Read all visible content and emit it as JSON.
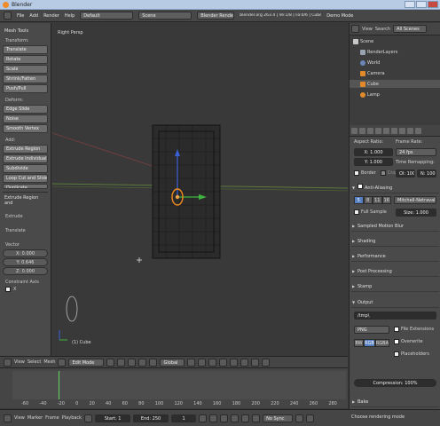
{
  "window": {
    "title": "Blender"
  },
  "menubar": {
    "items": [
      "File",
      "Add",
      "Render",
      "Help"
    ],
    "layout": "Default",
    "scene": "Scene",
    "engine": "Blender Render",
    "stats": "blender.org 263.4 | Ve:1/8 | Fa:0/6 | Cube",
    "demo": "Demo Mode"
  },
  "toolshelf": {
    "title": "Mesh Tools",
    "transform": {
      "label": "Transform:",
      "items": [
        "Translate",
        "Rotate",
        "Scale",
        "Shrink/Fatten",
        "Push/Pull"
      ]
    },
    "deform": {
      "label": "Deform:",
      "items": [
        "Edge Slide",
        "Noise",
        "Smooth Vertex"
      ]
    },
    "add": {
      "label": "Add:",
      "items": [
        "Extrude Region",
        "Extrude Individual",
        "Subdivide",
        "Loop Cut and Slide",
        "Duplicate"
      ]
    },
    "operator": {
      "title": "Extrude Region and",
      "items": [
        "Extrude",
        "Translate"
      ],
      "vector_label": "Vector",
      "vector": [
        "X: 0.000",
        "Y: 0.646",
        "Z: 0.000"
      ],
      "constraint_label": "Constraint Axis",
      "constraint_x": "X"
    }
  },
  "viewport": {
    "label": "Right Persp",
    "object": "(1) Cube"
  },
  "view3d_header": {
    "items": [
      "View",
      "Select",
      "Mesh"
    ],
    "mode": "Edit Mode",
    "orientation": "Global"
  },
  "timeline": {
    "ruler": [
      "-60",
      "-40",
      "-20",
      "0",
      "20",
      "40",
      "60",
      "80",
      "100",
      "120",
      "140",
      "160",
      "180",
      "200",
      "220",
      "240",
      "260",
      "280"
    ],
    "header_items": [
      "View",
      "Marker",
      "Frame",
      "Playback"
    ],
    "start": "Start: 1",
    "end": "End: 250",
    "current": "1",
    "sync": "No Sync"
  },
  "outliner": {
    "menu": [
      "View",
      "Search"
    ],
    "filter": "All Scenes",
    "rows": [
      "Scene",
      "RenderLayers",
      "World",
      "Camera",
      "Cube",
      "Lamp"
    ]
  },
  "properties": {
    "aspect_label": "Aspect Ratio:",
    "frame_rate_label": "Frame Rate:",
    "aspect_x": "X: 1.000",
    "aspect_y": "Y: 1.000",
    "fps": "24 fps",
    "time_remap_label": "Time Remapping:",
    "remap_old": "Ol: 100",
    "remap_new": "N: 100",
    "border": "Border",
    "crop": "Crop",
    "antialiasing": "Anti-Aliasing",
    "aa_samples": [
      "5",
      "8",
      "11",
      "16"
    ],
    "aa_filter": "Mitchell-Netravali",
    "full_sample": "Full Sample",
    "size": "Size: 1.000",
    "panels": [
      "Sampled Motion Blur",
      "Shading",
      "Performance",
      "Post Processing",
      "Stamp"
    ],
    "output_title": "Output",
    "output_path": "/tmp\\",
    "format": "PNG",
    "file_ext": "File Extensions",
    "overwrite": "Overwrite",
    "placeholders": "Placeholders",
    "color_modes": [
      "BW",
      "RGB",
      "RGBA"
    ],
    "compression": "Compression: 100%",
    "bake": "Bake",
    "status": "Choose rendering mode"
  }
}
